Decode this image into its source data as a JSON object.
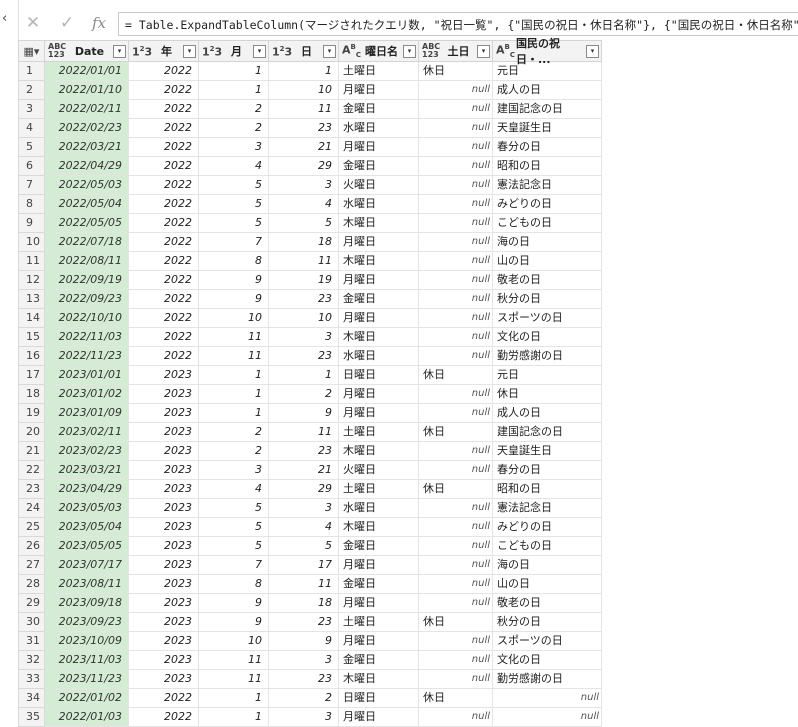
{
  "formula_bar": {
    "cancel_icon": "x-icon",
    "confirm_icon": "check-icon",
    "fx_label": "fx",
    "formula": "= Table.ExpandTableColumn(マージされたクエリ数, \"祝日一覧\", {\"国民の祝日・休日名称\"}, {\"国民の祝日・休日名称\"})"
  },
  "columns": [
    {
      "type_icon": "ABC123",
      "name": "Date"
    },
    {
      "type_icon": "123",
      "name": "年"
    },
    {
      "type_icon": "123",
      "name": "月"
    },
    {
      "type_icon": "123",
      "name": "日"
    },
    {
      "type_icon": "ABC",
      "name": "曜日名"
    },
    {
      "type_icon": "ABC123",
      "name": "土日"
    },
    {
      "type_icon": "ABC",
      "name": "国民の祝日・..."
    }
  ],
  "rows": [
    [
      "2022/01/01",
      "2022",
      "1",
      "1",
      "土曜日",
      "休日",
      "元日"
    ],
    [
      "2022/01/10",
      "2022",
      "1",
      "10",
      "月曜日",
      "null",
      "成人の日"
    ],
    [
      "2022/02/11",
      "2022",
      "2",
      "11",
      "金曜日",
      "null",
      "建国記念の日"
    ],
    [
      "2022/02/23",
      "2022",
      "2",
      "23",
      "水曜日",
      "null",
      "天皇誕生日"
    ],
    [
      "2022/03/21",
      "2022",
      "3",
      "21",
      "月曜日",
      "null",
      "春分の日"
    ],
    [
      "2022/04/29",
      "2022",
      "4",
      "29",
      "金曜日",
      "null",
      "昭和の日"
    ],
    [
      "2022/05/03",
      "2022",
      "5",
      "3",
      "火曜日",
      "null",
      "憲法記念日"
    ],
    [
      "2022/05/04",
      "2022",
      "5",
      "4",
      "水曜日",
      "null",
      "みどりの日"
    ],
    [
      "2022/05/05",
      "2022",
      "5",
      "5",
      "木曜日",
      "null",
      "こどもの日"
    ],
    [
      "2022/07/18",
      "2022",
      "7",
      "18",
      "月曜日",
      "null",
      "海の日"
    ],
    [
      "2022/08/11",
      "2022",
      "8",
      "11",
      "木曜日",
      "null",
      "山の日"
    ],
    [
      "2022/09/19",
      "2022",
      "9",
      "19",
      "月曜日",
      "null",
      "敬老の日"
    ],
    [
      "2022/09/23",
      "2022",
      "9",
      "23",
      "金曜日",
      "null",
      "秋分の日"
    ],
    [
      "2022/10/10",
      "2022",
      "10",
      "10",
      "月曜日",
      "null",
      "スポーツの日"
    ],
    [
      "2022/11/03",
      "2022",
      "11",
      "3",
      "木曜日",
      "null",
      "文化の日"
    ],
    [
      "2022/11/23",
      "2022",
      "11",
      "23",
      "水曜日",
      "null",
      "勤労感謝の日"
    ],
    [
      "2023/01/01",
      "2023",
      "1",
      "1",
      "日曜日",
      "休日",
      "元日"
    ],
    [
      "2023/01/02",
      "2023",
      "1",
      "2",
      "月曜日",
      "null",
      "休日"
    ],
    [
      "2023/01/09",
      "2023",
      "1",
      "9",
      "月曜日",
      "null",
      "成人の日"
    ],
    [
      "2023/02/11",
      "2023",
      "2",
      "11",
      "土曜日",
      "休日",
      "建国記念の日"
    ],
    [
      "2023/02/23",
      "2023",
      "2",
      "23",
      "木曜日",
      "null",
      "天皇誕生日"
    ],
    [
      "2023/03/21",
      "2023",
      "3",
      "21",
      "火曜日",
      "null",
      "春分の日"
    ],
    [
      "2023/04/29",
      "2023",
      "4",
      "29",
      "土曜日",
      "休日",
      "昭和の日"
    ],
    [
      "2023/05/03",
      "2023",
      "5",
      "3",
      "水曜日",
      "null",
      "憲法記念日"
    ],
    [
      "2023/05/04",
      "2023",
      "5",
      "4",
      "木曜日",
      "null",
      "みどりの日"
    ],
    [
      "2023/05/05",
      "2023",
      "5",
      "5",
      "金曜日",
      "null",
      "こどもの日"
    ],
    [
      "2023/07/17",
      "2023",
      "7",
      "17",
      "月曜日",
      "null",
      "海の日"
    ],
    [
      "2023/08/11",
      "2023",
      "8",
      "11",
      "金曜日",
      "null",
      "山の日"
    ],
    [
      "2023/09/18",
      "2023",
      "9",
      "18",
      "月曜日",
      "null",
      "敬老の日"
    ],
    [
      "2023/09/23",
      "2023",
      "9",
      "23",
      "土曜日",
      "休日",
      "秋分の日"
    ],
    [
      "2023/10/09",
      "2023",
      "10",
      "9",
      "月曜日",
      "null",
      "スポーツの日"
    ],
    [
      "2023/11/03",
      "2023",
      "11",
      "3",
      "金曜日",
      "null",
      "文化の日"
    ],
    [
      "2023/11/23",
      "2023",
      "11",
      "23",
      "木曜日",
      "null",
      "勤労感謝の日"
    ],
    [
      "2022/01/02",
      "2022",
      "1",
      "2",
      "日曜日",
      "休日",
      "null"
    ],
    [
      "2022/01/03",
      "2022",
      "1",
      "3",
      "月曜日",
      "null",
      "null"
    ]
  ],
  "colors": {
    "date_column_bg": "#d4ebd4",
    "header_bg": "#f3f3f3"
  }
}
